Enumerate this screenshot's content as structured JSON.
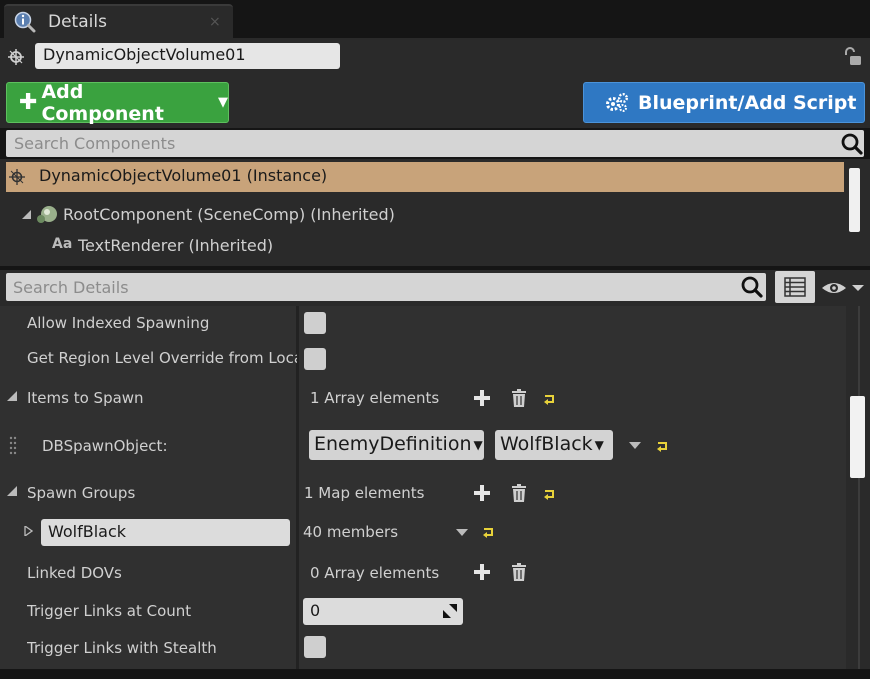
{
  "tab": {
    "title": "Details",
    "close": "×"
  },
  "actor": {
    "name": "DynamicObjectVolume01"
  },
  "toolbar": {
    "add_component_label": "Add Component",
    "add_component_color": "#3aa23f",
    "blueprint_label": "Blueprint/Add Script",
    "blueprint_color": "#2f78c3"
  },
  "components_search": {
    "placeholder": "Search Components"
  },
  "components_tree": {
    "instance_label": "DynamicObjectVolume01 (Instance)",
    "root_label": "RootComponent (SceneComp) (Inherited)",
    "text_renderer_label": "TextRenderer (Inherited)",
    "text_renderer_icon_glyph": "Aa",
    "selected_color": "#c8a37a"
  },
  "details_search": {
    "placeholder": "Search Details"
  },
  "properties": {
    "allow_indexed_spawning": {
      "label": "Allow Indexed Spawning",
      "checked": false
    },
    "region_level_override": {
      "label": "Get Region Level Override from Locati",
      "checked": false
    },
    "items_to_spawn": {
      "label": "Items to Spawn",
      "value": "1 Array elements"
    },
    "db_spawn_object": {
      "label": "DBSpawnObject:",
      "type_value": "EnemyDefinition",
      "item_value": "WolfBlack"
    },
    "spawn_groups": {
      "label": "Spawn Groups",
      "value": "1 Map elements"
    },
    "spawn_group_entry": {
      "key": "WolfBlack",
      "value": "40 members"
    },
    "linked_dovs": {
      "label": "Linked DOVs",
      "value": "0 Array elements"
    },
    "trigger_links_at_count": {
      "label": "Trigger Links at Count",
      "value": "0"
    },
    "trigger_links_with_stealth": {
      "label": "Trigger Links with Stealth",
      "checked": false
    }
  },
  "icons": {
    "reset_color": "#e8d23a",
    "tab_icon": "magnifier-info-icon",
    "actor_icon": "actor-icon",
    "lock_icon": "unlock-icon",
    "gear_icon": "gears-icon",
    "search_icon": "search-icon",
    "list_view_icon": "list-view-icon",
    "eye_icon": "eye-icon"
  }
}
